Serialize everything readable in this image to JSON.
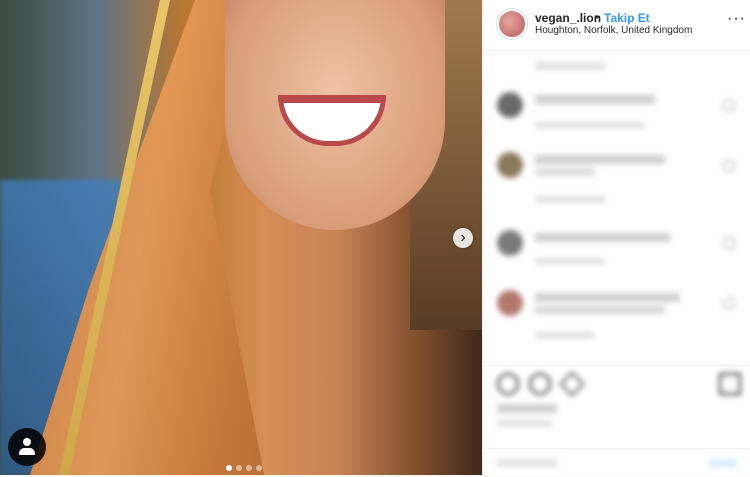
{
  "post": {
    "username": "vegan_.lion",
    "separator": "•",
    "follow_label": "Takip Et",
    "location": "Houghton, Norfolk, United Kingdom",
    "more_icon": "more-options-icon",
    "more_glyph": "···"
  },
  "photo": {
    "next_icon": "chevron-right-icon",
    "next_glyph": "›",
    "tag_icon": "user-tag-icon",
    "dots": 4,
    "active_dot": 0
  },
  "comments": [
    {
      "name": "",
      "meta": ""
    },
    {
      "name": "",
      "meta": ""
    },
    {
      "name": "",
      "meta": ""
    },
    {
      "name": "",
      "meta": ""
    },
    {
      "name": "",
      "meta": ""
    }
  ],
  "footer": {
    "likes": "",
    "date": "",
    "add_comment_placeholder": "",
    "post_label": ""
  },
  "colors": {
    "accent": "#3897f0",
    "text": "#262626",
    "muted": "#999999"
  }
}
